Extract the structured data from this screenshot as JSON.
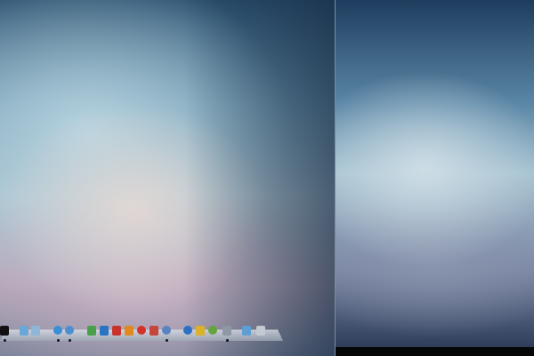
{
  "desktop": {
    "left_wallpaper": "blurred-blue-pink-gradient",
    "right_wallpaper": "blurred-blue-gradient"
  },
  "dock": {
    "items": [
      {
        "name": "terminal-icon",
        "color": "#111111"
      },
      {
        "name": "finder-icon",
        "color": "#6aa7d8"
      },
      {
        "name": "mail-icon",
        "color": "#8fb6d6"
      },
      {
        "name": "safari-icon",
        "color": "#3b8fd6"
      },
      {
        "name": "itunes-icon",
        "color": "#4b8fd0"
      },
      {
        "name": "app-green-icon",
        "color": "#4aa04a"
      },
      {
        "name": "app-blue-icon",
        "color": "#2a74c2"
      },
      {
        "name": "app-red-icon",
        "color": "#c9332b"
      },
      {
        "name": "app-orange-icon",
        "color": "#e08a1e"
      },
      {
        "name": "app-red-round-icon",
        "color": "#d4312a"
      },
      {
        "name": "app-red-white-icon",
        "color": "#c4463c"
      },
      {
        "name": "app-globe-icon",
        "color": "#5a82c0"
      },
      {
        "name": "app-blue-round-icon",
        "color": "#2d6fc4"
      },
      {
        "name": "app-yellow-icon",
        "color": "#d9b12a"
      },
      {
        "name": "app-green-round-icon",
        "color": "#64a43a"
      },
      {
        "name": "app-grey-icon",
        "color": "#8f97a3"
      },
      {
        "name": "folder-icon",
        "color": "#5f9ed4"
      },
      {
        "name": "trash-icon",
        "color": "#c4cad2"
      }
    ]
  }
}
